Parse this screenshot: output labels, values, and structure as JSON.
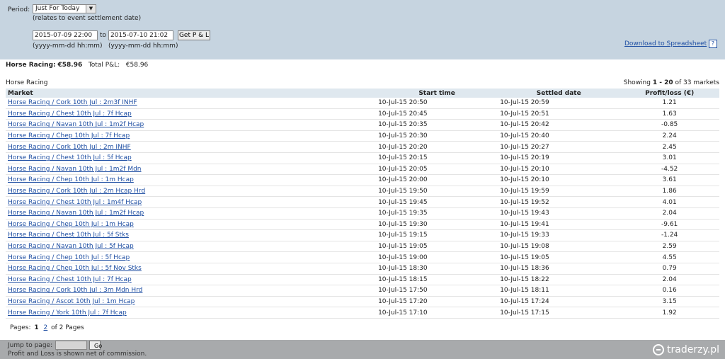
{
  "filter": {
    "period_label": "Period:",
    "period_value": "Just For Today",
    "period_note": "(relates to event settlement date)",
    "from_value": "2015-07-09 22:00",
    "to_label": "to",
    "to_value": "2015-07-10 21:02",
    "get_button": "Get P & L",
    "from_format": "(yyyy-mm-dd hh:mm)",
    "to_format": "(yyyy-mm-dd hh:mm)",
    "download_link": "Download to Spreadsheet",
    "help_glyph": "?"
  },
  "summary": {
    "category_label": "Horse Racing:",
    "category_value": "€58.96",
    "total_label": "Total P&L:",
    "total_value": "€58.96"
  },
  "section": {
    "title": "Horse Racing",
    "showing_prefix": "Showing",
    "showing_range": "1 - 20",
    "showing_suffix": "of 33 markets"
  },
  "table": {
    "headers": [
      "Market",
      "Start time",
      "Settled date",
      "Profit/loss (€)"
    ],
    "rows": [
      {
        "market": "Horse Racing / Cork 10th Jul : 2m3f INHF",
        "start": "10-Jul-15 20:50",
        "settled": "10-Jul-15 20:59",
        "pl": "1.21"
      },
      {
        "market": "Horse Racing / Chest 10th Jul : 7f Hcap",
        "start": "10-Jul-15 20:45",
        "settled": "10-Jul-15 20:51",
        "pl": "1.63"
      },
      {
        "market": "Horse Racing / Navan 10th Jul : 1m2f Hcap",
        "start": "10-Jul-15 20:35",
        "settled": "10-Jul-15 20:42",
        "pl": "-0.85"
      },
      {
        "market": "Horse Racing / Chep 10th Jul : 7f Hcap",
        "start": "10-Jul-15 20:30",
        "settled": "10-Jul-15 20:40",
        "pl": "2.24"
      },
      {
        "market": "Horse Racing / Cork 10th Jul : 2m INHF",
        "start": "10-Jul-15 20:20",
        "settled": "10-Jul-15 20:27",
        "pl": "2.45"
      },
      {
        "market": "Horse Racing / Chest 10th Jul : 5f Hcap",
        "start": "10-Jul-15 20:15",
        "settled": "10-Jul-15 20:19",
        "pl": "3.01"
      },
      {
        "market": "Horse Racing / Navan 10th Jul : 1m2f Mdn",
        "start": "10-Jul-15 20:05",
        "settled": "10-Jul-15 20:10",
        "pl": "-4.52"
      },
      {
        "market": "Horse Racing / Chep 10th Jul : 1m Hcap",
        "start": "10-Jul-15 20:00",
        "settled": "10-Jul-15 20:10",
        "pl": "3.61"
      },
      {
        "market": "Horse Racing / Cork 10th Jul : 2m Hcap Hrd",
        "start": "10-Jul-15 19:50",
        "settled": "10-Jul-15 19:59",
        "pl": "1.86"
      },
      {
        "market": "Horse Racing / Chest 10th Jul : 1m4f Hcap",
        "start": "10-Jul-15 19:45",
        "settled": "10-Jul-15 19:52",
        "pl": "4.01"
      },
      {
        "market": "Horse Racing / Navan 10th Jul : 1m2f Hcap",
        "start": "10-Jul-15 19:35",
        "settled": "10-Jul-15 19:43",
        "pl": "2.04"
      },
      {
        "market": "Horse Racing / Chep 10th Jul : 1m Hcap",
        "start": "10-Jul-15 19:30",
        "settled": "10-Jul-15 19:41",
        "pl": "-9.61"
      },
      {
        "market": "Horse Racing / Chest 10th Jul : 5f Stks",
        "start": "10-Jul-15 19:15",
        "settled": "10-Jul-15 19:33",
        "pl": "-1.24"
      },
      {
        "market": "Horse Racing / Navan 10th Jul : 5f Hcap",
        "start": "10-Jul-15 19:05",
        "settled": "10-Jul-15 19:08",
        "pl": "2.59"
      },
      {
        "market": "Horse Racing / Chep 10th Jul : 5f Hcap",
        "start": "10-Jul-15 19:00",
        "settled": "10-Jul-15 19:05",
        "pl": "4.55"
      },
      {
        "market": "Horse Racing / Chep 10th Jul : 5f Nov Stks",
        "start": "10-Jul-15 18:30",
        "settled": "10-Jul-15 18:36",
        "pl": "0.79"
      },
      {
        "market": "Horse Racing / Chest 10th Jul : 7f Hcap",
        "start": "10-Jul-15 18:15",
        "settled": "10-Jul-15 18:22",
        "pl": "2.04"
      },
      {
        "market": "Horse Racing / Cork 10th Jul : 3m Mdn Hrd",
        "start": "10-Jul-15 17:50",
        "settled": "10-Jul-15 18:11",
        "pl": "0.16"
      },
      {
        "market": "Horse Racing / Ascot 10th Jul : 1m Hcap",
        "start": "10-Jul-15 17:20",
        "settled": "10-Jul-15 17:24",
        "pl": "3.15"
      },
      {
        "market": "Horse Racing / York 10th Jul : 7f Hcap",
        "start": "10-Jul-15 17:10",
        "settled": "10-Jul-15 17:15",
        "pl": "1.92"
      }
    ]
  },
  "pagination": {
    "label": "Pages:",
    "current": "1",
    "other": "2",
    "suffix": "of 2 Pages"
  },
  "footer": {
    "jump_label": "Jump to page:",
    "go_button": "Go",
    "note": "Profit and Loss is shown net of commission.",
    "watermark": "traderzy.pl"
  }
}
